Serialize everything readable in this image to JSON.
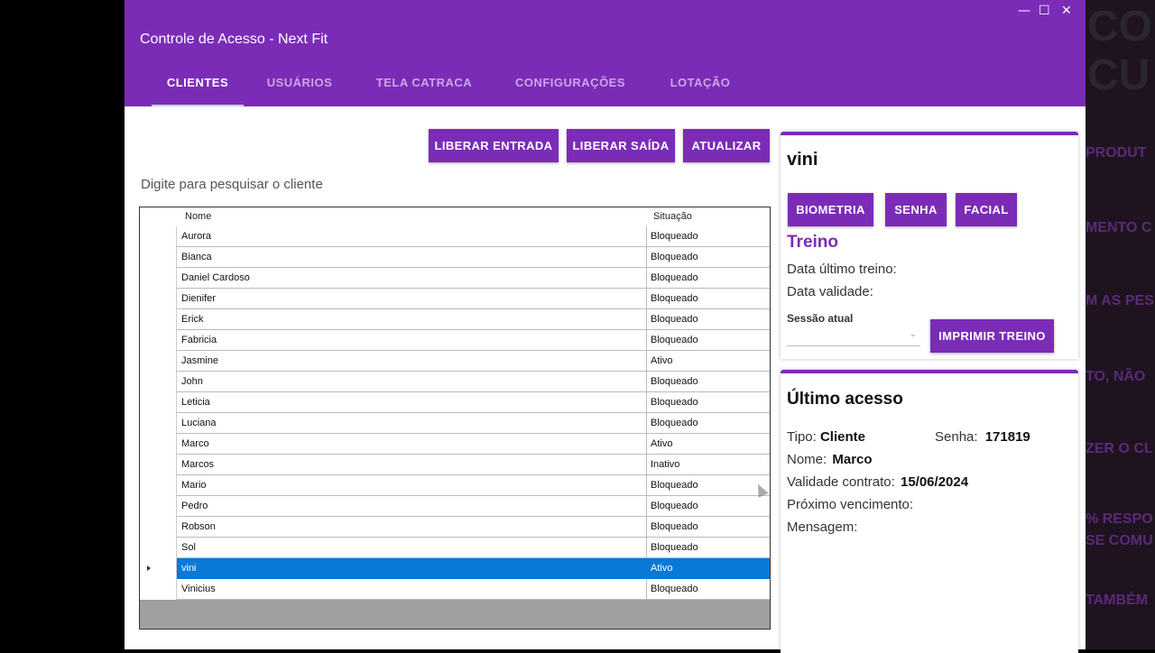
{
  "window": {
    "title": "Controle de Acesso - Next Fit",
    "controls": {
      "minimize": "—",
      "maximize": "☐",
      "close": "✕"
    }
  },
  "tabs": [
    {
      "label": "CLIENTES",
      "active": true
    },
    {
      "label": "USUÁRIOS",
      "active": false
    },
    {
      "label": "TELA CATRACA",
      "active": false
    },
    {
      "label": "CONFIGURAÇÕES",
      "active": false
    },
    {
      "label": "LOTAÇÃO",
      "active": false
    }
  ],
  "toolbar": {
    "liberar_entrada": "LIBERAR ENTRADA",
    "liberar_saida": "LIBERAR SAÍDA",
    "atualizar": "ATUALIZAR"
  },
  "search": {
    "placeholder": "Digite para pesquisar o cliente"
  },
  "table": {
    "columns": [
      "Nome",
      "Situação"
    ],
    "rows": [
      {
        "name": "Aurora",
        "status": "Bloqueado"
      },
      {
        "name": "Bianca",
        "status": "Bloqueado"
      },
      {
        "name": "Daniel Cardoso",
        "status": "Bloqueado"
      },
      {
        "name": "Dienifer",
        "status": "Bloqueado"
      },
      {
        "name": "Erick",
        "status": "Bloqueado"
      },
      {
        "name": "Fabricia",
        "status": "Bloqueado"
      },
      {
        "name": "Jasmine",
        "status": "Ativo"
      },
      {
        "name": "John",
        "status": "Bloqueado"
      },
      {
        "name": "Leticia",
        "status": "Bloqueado"
      },
      {
        "name": "Luciana",
        "status": "Bloqueado"
      },
      {
        "name": "Marco",
        "status": "Ativo"
      },
      {
        "name": "Marcos",
        "status": "Inativo"
      },
      {
        "name": "Mario",
        "status": "Bloqueado"
      },
      {
        "name": "Pedro",
        "status": "Bloqueado"
      },
      {
        "name": "Robson",
        "status": "Bloqueado"
      },
      {
        "name": "Sol",
        "status": "Bloqueado"
      },
      {
        "name": "vini",
        "status": "Ativo"
      },
      {
        "name": "Vinicius",
        "status": "Bloqueado"
      }
    ],
    "selected_index": 16
  },
  "client_panel": {
    "name": "vini",
    "buttons": {
      "biometria": "BIOMETRIA",
      "senha": "SENHA",
      "facial": "FACIAL"
    },
    "treino_title": "Treino",
    "data_ultimo_treino": "Data último treino:",
    "data_validade": "Data validade:",
    "sessao_atual": "Sessão atual",
    "imprimir_treino": "IMPRIMIR TREINO"
  },
  "last_access": {
    "title": "Último acesso",
    "tipo_label": "Tipo:",
    "tipo_value": "Cliente",
    "senha_label": "Senha:",
    "senha_value": "171819",
    "nome_label": "Nome:",
    "nome_value": "Marco",
    "validade_label": "Validade contrato:",
    "validade_value": "15/06/2024",
    "proximo_label": "Próximo vencimento:",
    "mensagem_label": "Mensagem:"
  },
  "background": {
    "big_text": [
      "CO",
      "CU"
    ],
    "lines": [
      "PRODUT",
      "MENTO C",
      "M AS PES",
      "TO, NÃO",
      "ZER O CL",
      "% RESPO",
      "SE COMU",
      "TAMBÉM"
    ]
  },
  "colors": {
    "accent": "#7b2cb7",
    "selection": "#0a78d7"
  }
}
